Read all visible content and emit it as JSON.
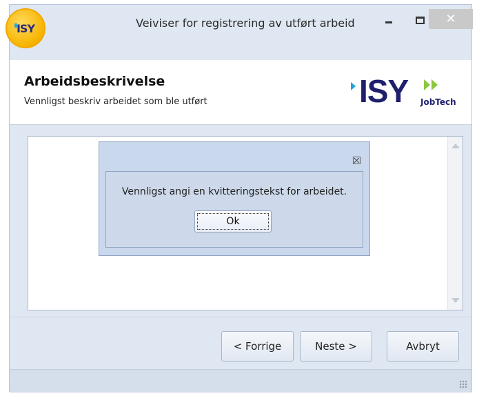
{
  "window": {
    "title": "Veiviser for registrering av utført arbeid",
    "app_logo_text": "ISY",
    "controls": {
      "minimize": "minimize-icon",
      "maximize": "maximize-icon",
      "close": "✕"
    }
  },
  "header": {
    "title": "Arbeidsbeskrivelse",
    "subtitle": "Vennligst beskriv arbeidet som ble utført",
    "brand": {
      "name": "ISY",
      "tagline": "JobTech"
    }
  },
  "dialog": {
    "close_glyph": "☒",
    "message": "Vennligst angi en kvitteringstekst for arbeidet.",
    "ok_label": "Ok"
  },
  "footer": {
    "prev_label": "< Forrige",
    "next_label": "Neste >",
    "cancel_label": "Avbryt"
  },
  "colors": {
    "chrome": "#dfe7f2",
    "brand_navy": "#1f1f6e",
    "brand_cyan": "#1aa6d6",
    "brand_green": "#8cc63f",
    "logo_gold": "#f6b400"
  }
}
